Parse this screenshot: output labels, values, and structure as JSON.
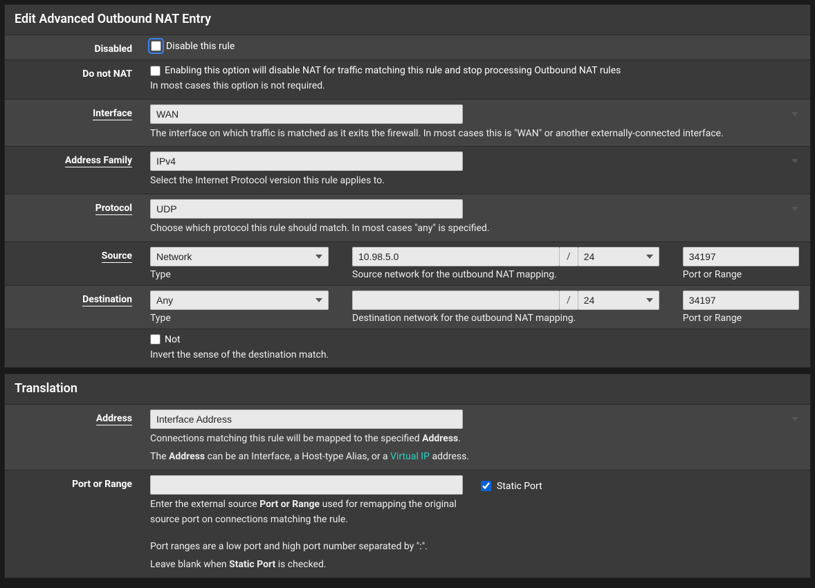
{
  "panel1": {
    "title": "Edit Advanced Outbound NAT Entry",
    "disabled": {
      "label": "Disabled",
      "cb_label": "Disable this rule"
    },
    "donotnat": {
      "label": "Do not NAT",
      "cb_label": "Enabling this option will disable NAT for traffic matching this rule and stop processing Outbound NAT rules",
      "help": "In most cases this option is not required."
    },
    "interface": {
      "label": "Interface",
      "value": "WAN",
      "help": "The interface on which traffic is matched as it exits the firewall. In most cases this is \"WAN\" or another externally-connected interface."
    },
    "address_family": {
      "label": "Address Family",
      "value": "IPv4",
      "help": "Select the Internet Protocol version this rule applies to."
    },
    "protocol": {
      "label": "Protocol",
      "value": "UDP",
      "help": "Choose which protocol this rule should match. In most cases \"any\" is specified."
    },
    "source": {
      "label": "Source",
      "type_value": "Network",
      "type_caption": "Type",
      "net_value": "10.98.5.0",
      "mask_value": "24",
      "net_caption": "Source network for the outbound NAT mapping.",
      "port_value": "34197",
      "port_caption": "Port or Range"
    },
    "destination": {
      "label": "Destination",
      "type_value": "Any",
      "type_caption": "Type",
      "net_value": "",
      "mask_value": "24",
      "net_caption": "Destination network for the outbound NAT mapping.",
      "port_value": "34197",
      "port_caption": "Port or Range"
    },
    "not": {
      "cb_label": "Not",
      "help": "Invert the sense of the destination match."
    }
  },
  "panel2": {
    "title": "Translation",
    "address": {
      "label": "Address",
      "value": "Interface Address",
      "help1a": "Connections matching this rule will be mapped to the specified ",
      "help1b": "Address",
      "help1c": ".",
      "help2a": "The ",
      "help2b": "Address",
      "help2c": " can be an Interface, a Host-type Alias, or a ",
      "help2_link": "Virtual IP",
      "help2d": " address."
    },
    "port": {
      "label": "Port or Range",
      "value": "",
      "static_label": "Static Port",
      "help1a": "Enter the external source ",
      "help1b": "Port or Range",
      "help1c": " used for remapping the original source port on connections matching the rule.",
      "help2": "Port ranges are a low port and high port number separated by \":\".",
      "help3a": "Leave blank when ",
      "help3b": "Static Port",
      "help3c": " is checked."
    }
  }
}
